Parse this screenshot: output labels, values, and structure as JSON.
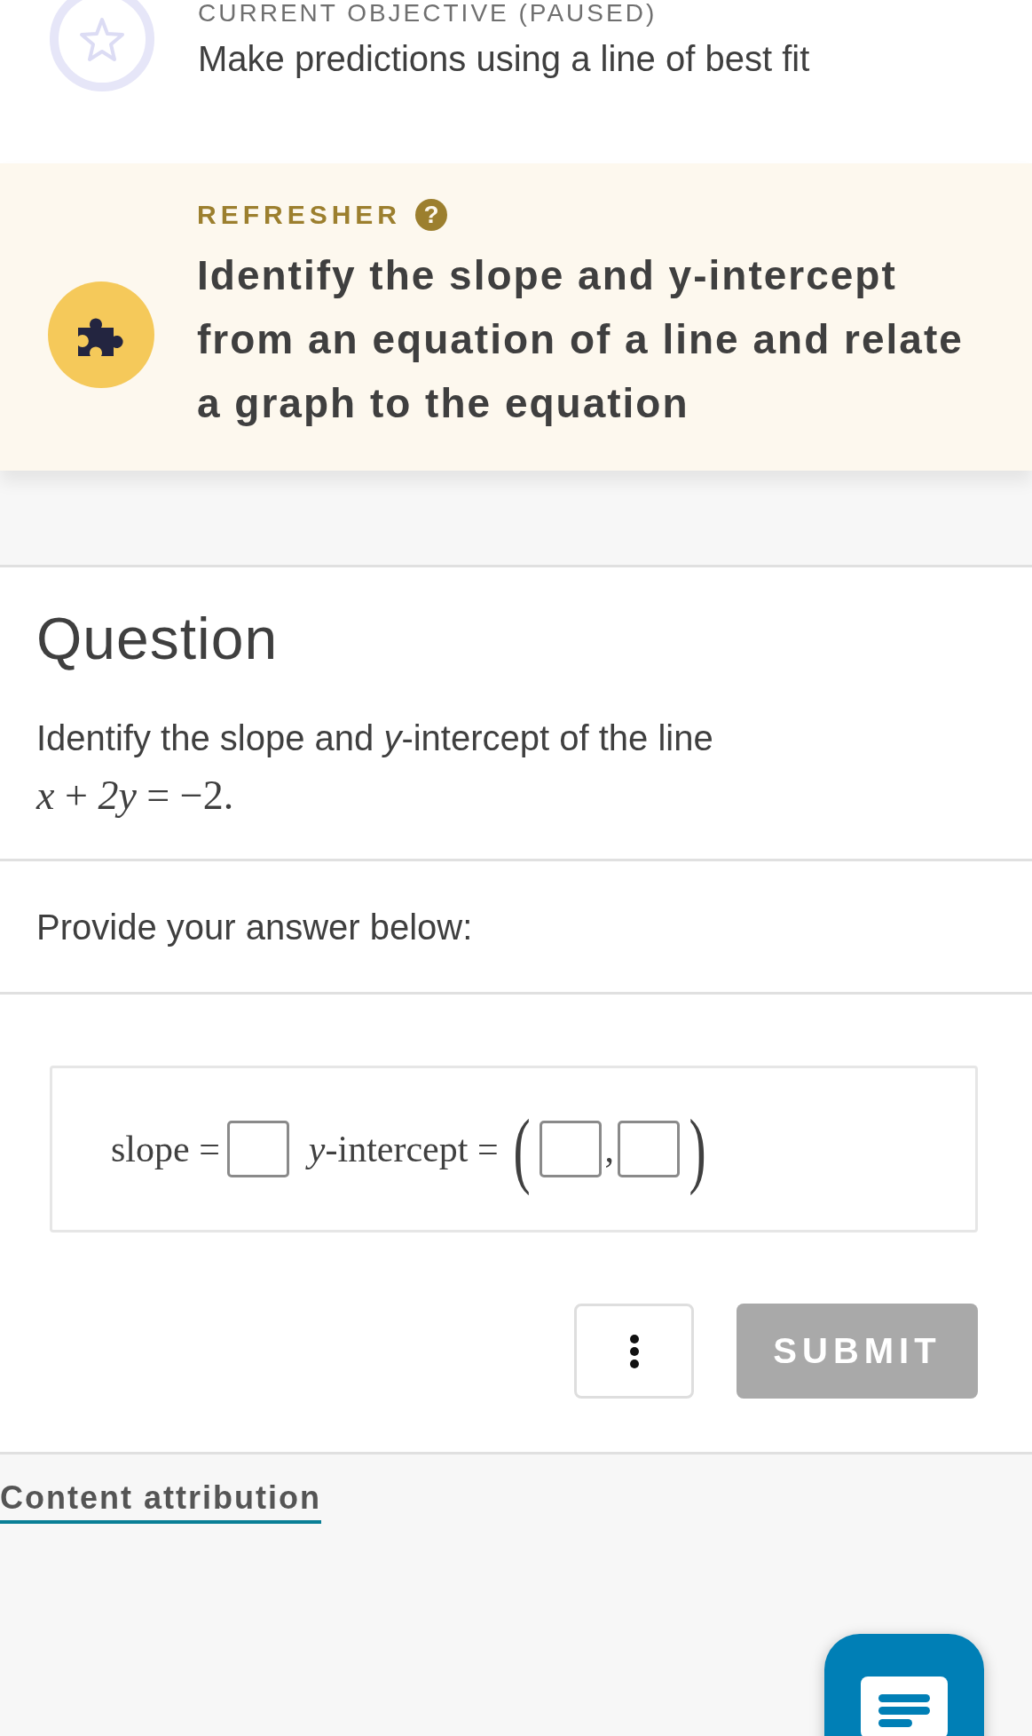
{
  "objective": {
    "label": "CURRENT OBJECTIVE (PAUSED)",
    "title": "Make predictions using a line of best fit",
    "paused": true
  },
  "refresher": {
    "label": "REFRESHER",
    "help": "?",
    "title": "Identify the slope and y-intercept from an equation of a line and relate a graph to the equation"
  },
  "question": {
    "heading": "Question",
    "text": "Identify the slope and *y*-intercept of the line",
    "equation": "*x* + *2y* = −2."
  },
  "prompt": "Provide your answer below:",
  "answer": {
    "slope_label": "slope =",
    "intercept_label": "*y*-intercept =",
    "open_paren": "(",
    "separator": ",",
    "close_paren": ")"
  },
  "actions": {
    "submit": {
      "label": "SUBMIT",
      "disabled": true
    }
  },
  "footer": {
    "link": "Content attribution"
  }
}
